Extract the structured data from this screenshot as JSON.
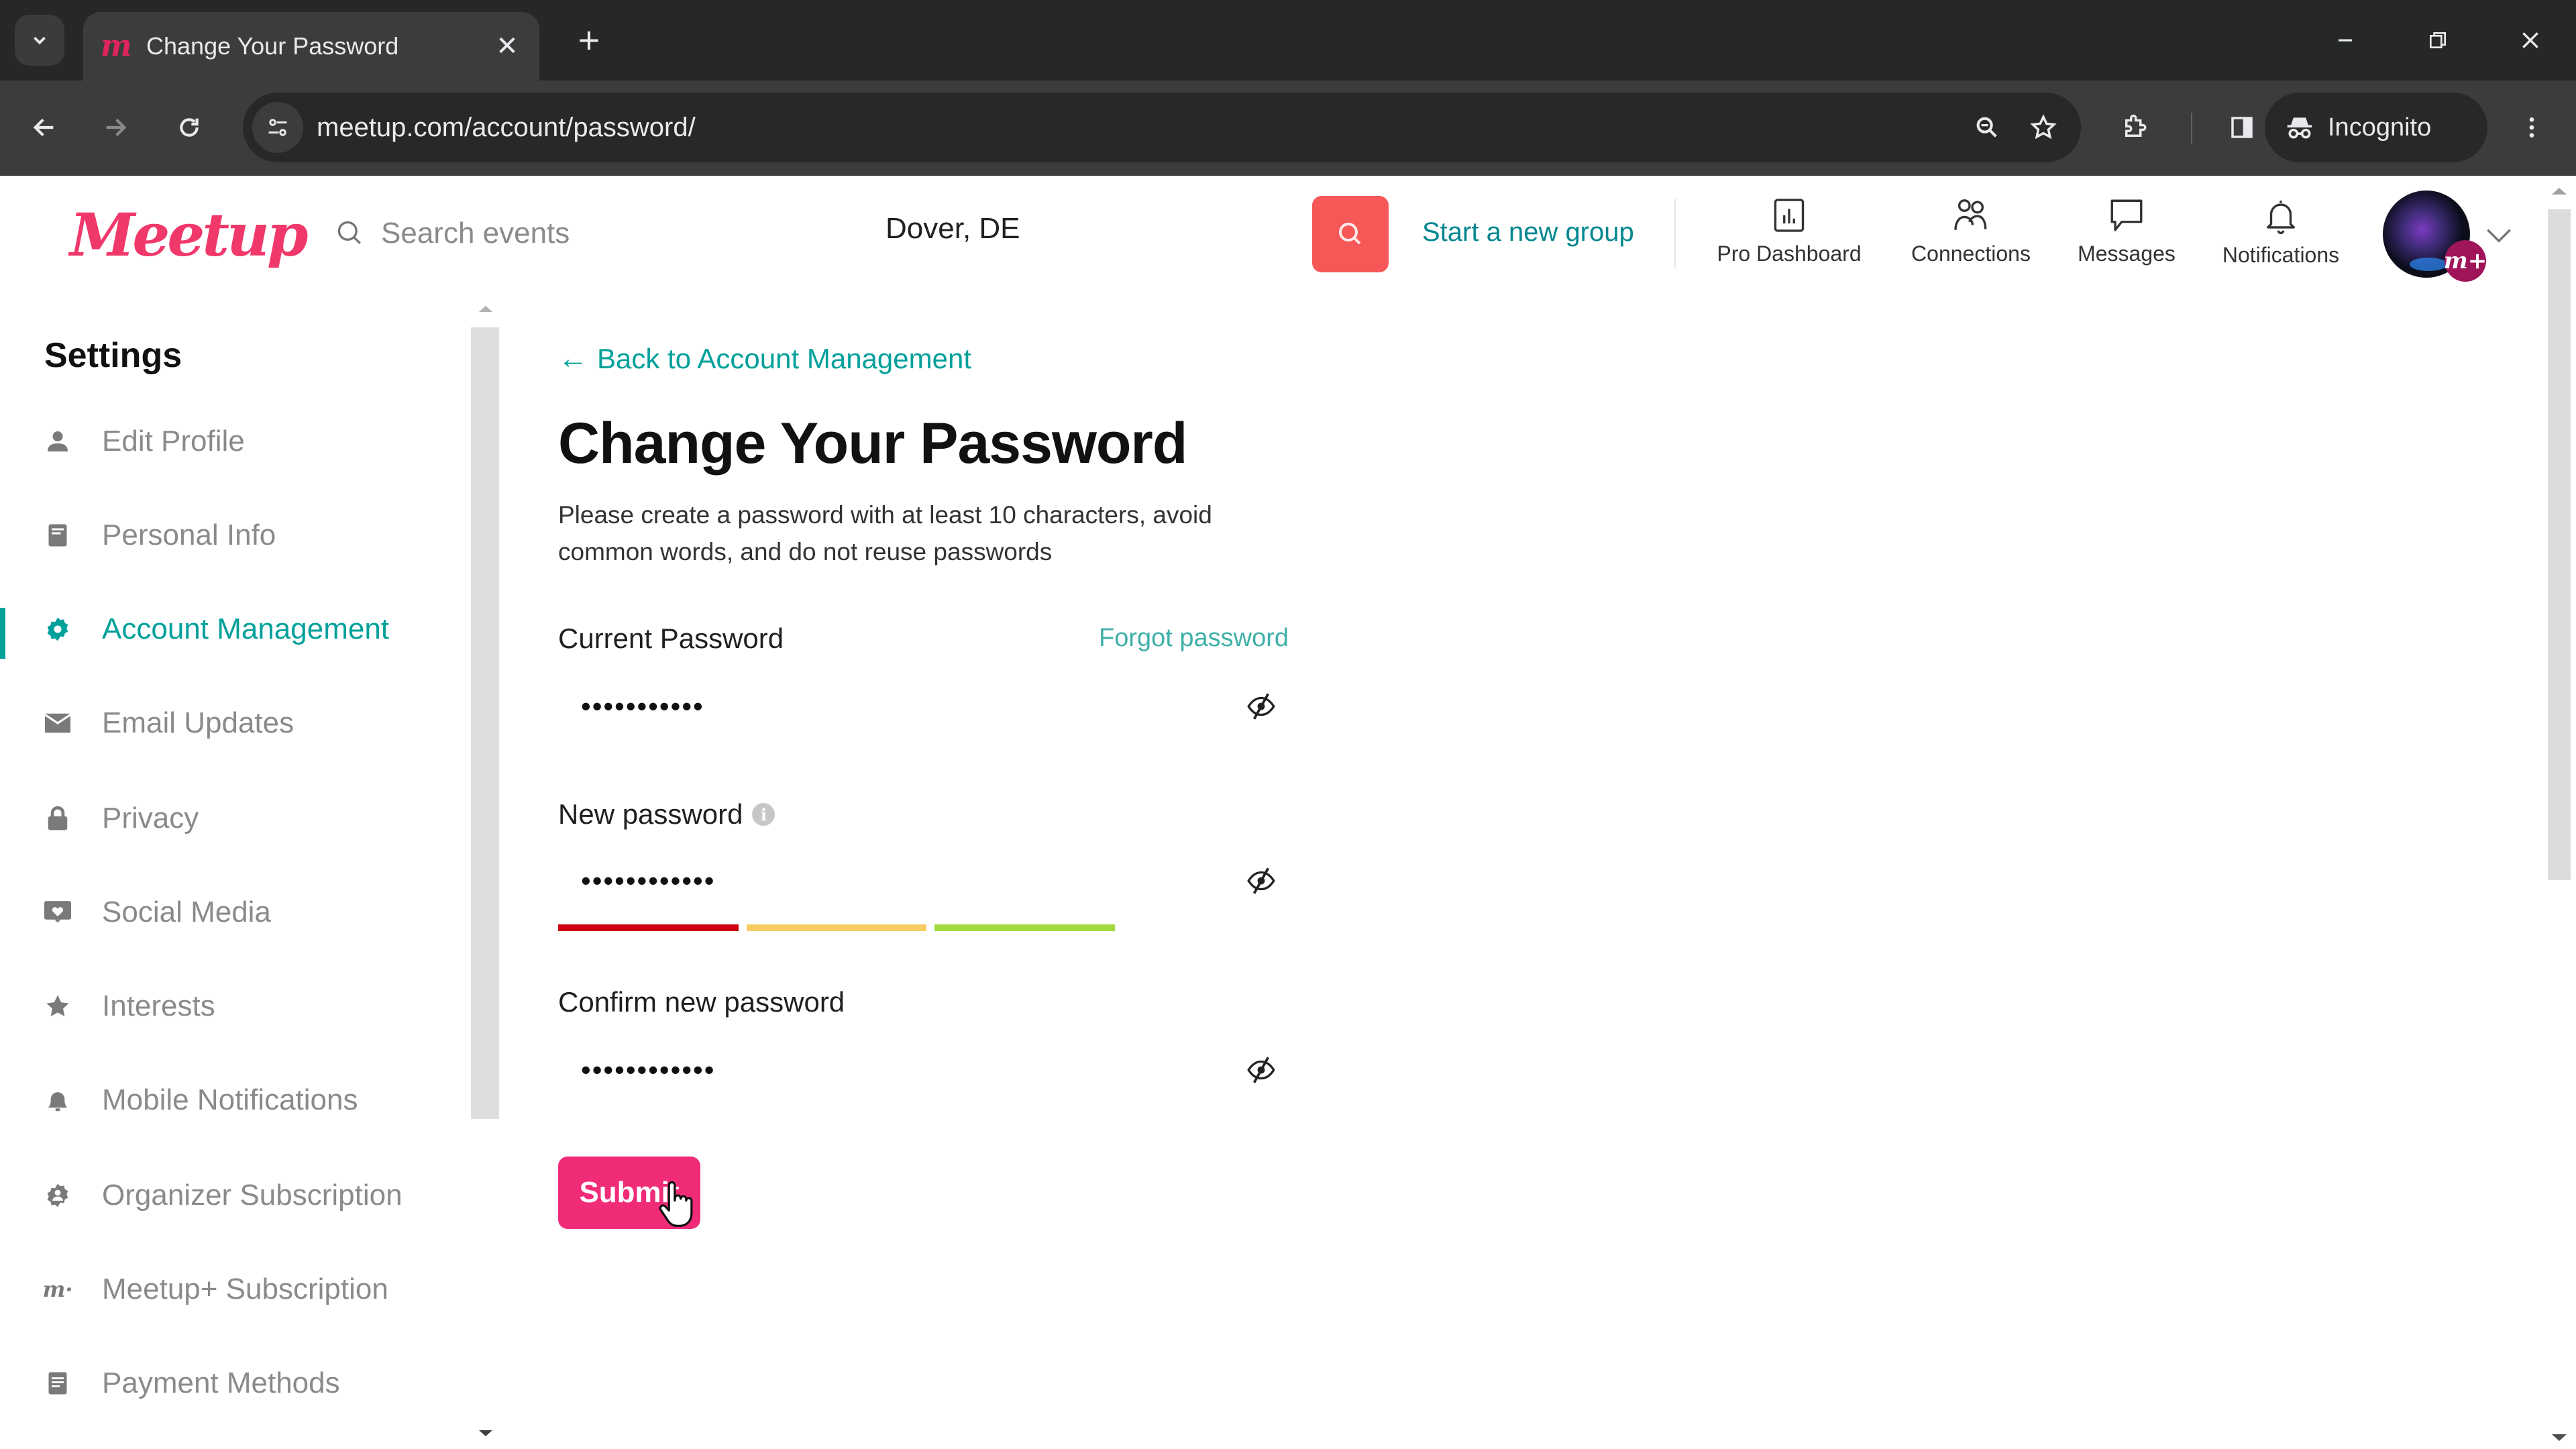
{
  "browser": {
    "tab_title": "Change Your Password",
    "url": "meetup.com/account/password/",
    "incognito_label": "Incognito"
  },
  "header": {
    "logo_text": "Meetup",
    "search_placeholder": "Search events",
    "location_value": "Dover, DE",
    "start_group_label": "Start a new group",
    "nav": [
      {
        "label": "Pro Dashboard",
        "icon": "bar-chart-icon"
      },
      {
        "label": "Connections",
        "icon": "people-icon"
      },
      {
        "label": "Messages",
        "icon": "chat-bubble-icon"
      },
      {
        "label": "Notifications",
        "icon": "bell-icon"
      }
    ],
    "avatar_badge": "m+"
  },
  "sidebar": {
    "title": "Settings",
    "active_index": 2,
    "items": [
      {
        "label": "Edit Profile",
        "icon": "person-icon"
      },
      {
        "label": "Personal Info",
        "icon": "document-icon"
      },
      {
        "label": "Account Management",
        "icon": "gear-icon"
      },
      {
        "label": "Email Updates",
        "icon": "envelope-icon"
      },
      {
        "label": "Privacy",
        "icon": "lock-icon"
      },
      {
        "label": "Social Media",
        "icon": "heart-screen-icon"
      },
      {
        "label": "Interests",
        "icon": "star-icon"
      },
      {
        "label": "Mobile Notifications",
        "icon": "bell-icon"
      },
      {
        "label": "Organizer Subscription",
        "icon": "organizer-badge-icon"
      },
      {
        "label": "Meetup+ Subscription",
        "icon": "meetup-plus-icon"
      },
      {
        "label": "Payment Methods",
        "icon": "card-icon"
      }
    ]
  },
  "main": {
    "back_link": "Back to Account Management",
    "title": "Change Your Password",
    "description": "Please create a password with at least 10 characters, avoid common words, and do not reuse passwords",
    "current_password": {
      "label": "Current Password",
      "forgot_link": "Forgot password",
      "value": "•••••••••••"
    },
    "new_password": {
      "label": "New password",
      "value": "••••••••••••",
      "strength_levels": 3,
      "strength_filled": 3
    },
    "confirm_password": {
      "label": "Confirm new password",
      "value": "••••••••••••"
    },
    "submit_label": "Submit"
  },
  "colors": {
    "brand_pink": "#f02c79",
    "logo_pink": "#f0386b",
    "search_button": "#f65858",
    "teal_accent": "#00a09b",
    "strength_weak": "#cc0012",
    "strength_medium": "#f7cd63",
    "strength_strong": "#a2d93f"
  }
}
